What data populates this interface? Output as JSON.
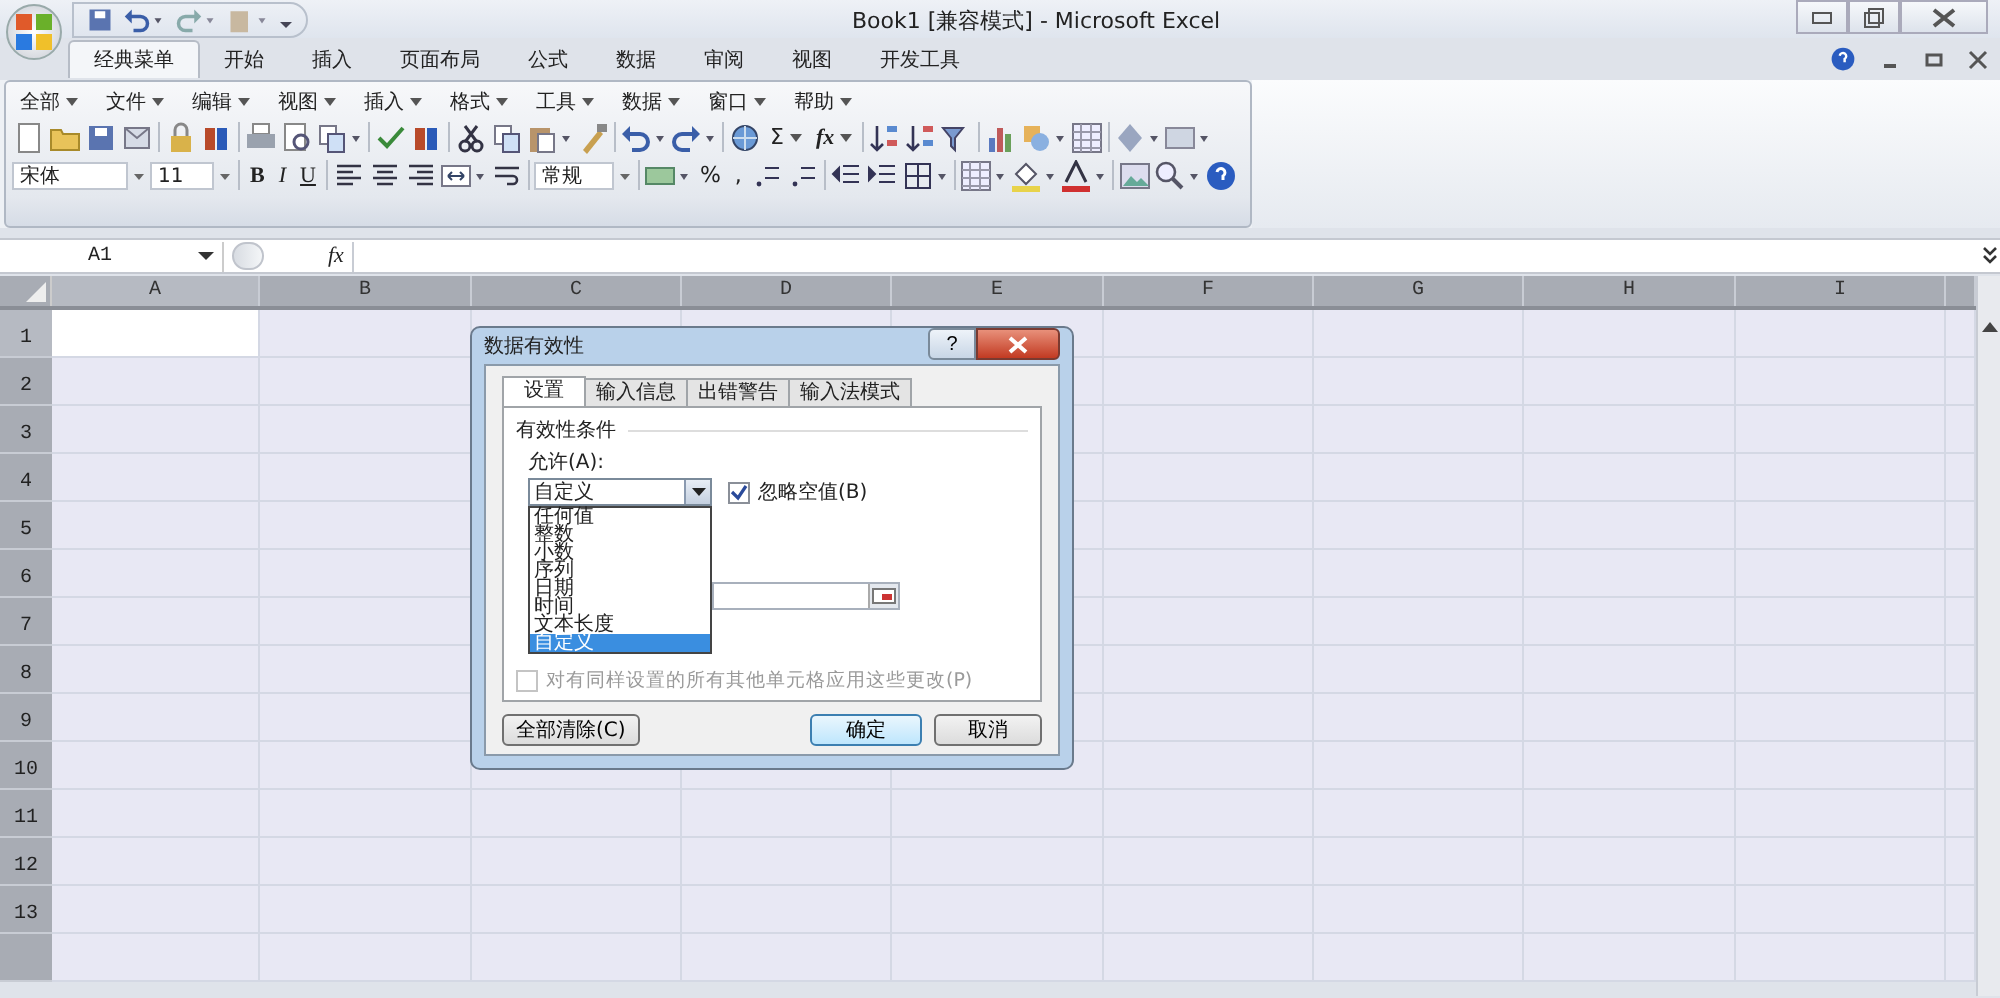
{
  "title_bar": {
    "title": "Book1  [兼容模式] - Microsoft Excel"
  },
  "ribbon_tabs": [
    {
      "label": "经典菜单",
      "selected": true
    },
    {
      "label": "开始",
      "selected": false
    },
    {
      "label": "插入",
      "selected": false
    },
    {
      "label": "页面布局",
      "selected": false
    },
    {
      "label": "公式",
      "selected": false
    },
    {
      "label": "数据",
      "selected": false
    },
    {
      "label": "审阅",
      "selected": false
    },
    {
      "label": "视图",
      "selected": false
    },
    {
      "label": "开发工具",
      "selected": false
    }
  ],
  "classic_menu": [
    "全部",
    "文件",
    "编辑",
    "视图",
    "插入",
    "格式",
    "工具",
    "数据",
    "窗口",
    "帮助"
  ],
  "standard_toolbar": {
    "sum": "Σ",
    "function": "fx"
  },
  "formatting_toolbar": {
    "font": "宋体",
    "size": "11",
    "bold": "B",
    "italic": "I",
    "underline": "U",
    "number_format": "常规",
    "percent": "%",
    "comma": ","
  },
  "formula_bar": {
    "name_box": "A1",
    "function": "fx"
  },
  "sheet": {
    "columns": [
      {
        "label": "A",
        "selected": true
      },
      {
        "label": "B",
        "selected": false
      },
      {
        "label": "C",
        "selected": false
      },
      {
        "label": "D",
        "selected": false
      },
      {
        "label": "E",
        "selected": false
      },
      {
        "label": "F",
        "selected": false
      },
      {
        "label": "G",
        "selected": false
      },
      {
        "label": "H",
        "selected": false
      },
      {
        "label": "I",
        "selected": false
      }
    ],
    "rows": [
      {
        "label": "1",
        "selected": true
      },
      {
        "label": "2",
        "selected": false
      },
      {
        "label": "3",
        "selected": false
      },
      {
        "label": "4",
        "selected": false
      },
      {
        "label": "5",
        "selected": false
      },
      {
        "label": "6",
        "selected": false
      },
      {
        "label": "7",
        "selected": false
      },
      {
        "label": "8",
        "selected": false
      },
      {
        "label": "9",
        "selected": false
      },
      {
        "label": "10",
        "selected": false
      },
      {
        "label": "11",
        "selected": false
      },
      {
        "label": "12",
        "selected": false
      },
      {
        "label": "13",
        "selected": false
      }
    ]
  },
  "dialog": {
    "title": "数据有效性",
    "help": "?",
    "tabs": [
      {
        "label": "设置",
        "selected": true
      },
      {
        "label": "输入信息",
        "selected": false
      },
      {
        "label": "出错警告",
        "selected": false
      },
      {
        "label": "输入法模式",
        "selected": false
      }
    ],
    "group_label": "有效性条件",
    "allow_label": "允许(A):",
    "allow_value": "自定义",
    "ignore_blank": {
      "label": "忽略空值(B)",
      "checked": true
    },
    "dropdown_options": [
      {
        "label": "任何值",
        "selected": false
      },
      {
        "label": "整数",
        "selected": false
      },
      {
        "label": "小数",
        "selected": false
      },
      {
        "label": "序列",
        "selected": false
      },
      {
        "label": "日期",
        "selected": false
      },
      {
        "label": "时间",
        "selected": false
      },
      {
        "label": "文本长度",
        "selected": false
      },
      {
        "label": "自定义",
        "selected": true
      }
    ],
    "apply_all": {
      "label": "对有同样设置的所有其他单元格应用这些更改(P)",
      "checked": false,
      "disabled": true
    },
    "buttons": {
      "clear_all": "全部清除(C)",
      "ok": "确定",
      "cancel": "取消"
    }
  }
}
